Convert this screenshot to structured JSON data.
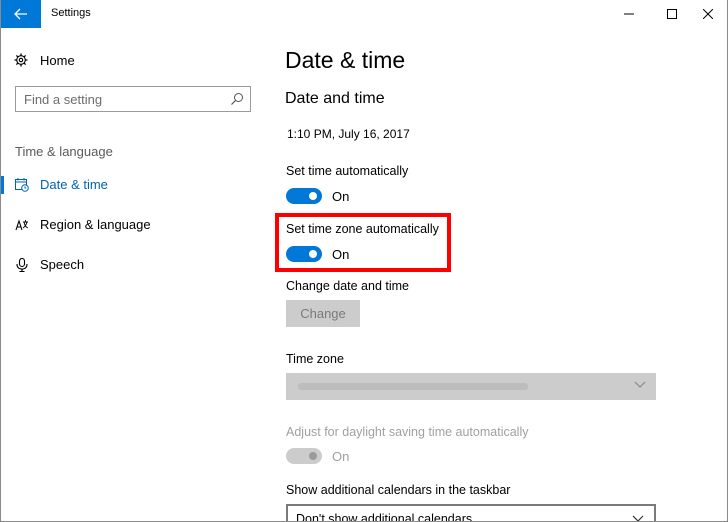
{
  "window": {
    "title": "Settings"
  },
  "sidebar": {
    "home_label": "Home",
    "search_placeholder": "Find a setting",
    "section_label": "Time & language",
    "items": [
      {
        "label": "Date & time",
        "icon": "calendar-clock-icon",
        "selected": true
      },
      {
        "label": "Region & language",
        "icon": "language-icon",
        "selected": false
      },
      {
        "label": "Speech",
        "icon": "microphone-icon",
        "selected": false
      }
    ]
  },
  "main": {
    "page_title": "Date & time",
    "section_title": "Date and time",
    "current_datetime": "1:10 PM, July 16, 2017",
    "set_time_auto": {
      "label": "Set time automatically",
      "state": "On"
    },
    "set_tz_auto": {
      "label": "Set time zone automatically",
      "state": "On"
    },
    "change_datetime": {
      "label": "Change date and time",
      "button": "Change"
    },
    "time_zone": {
      "label": "Time zone"
    },
    "daylight": {
      "label": "Adjust for daylight saving time automatically",
      "state": "On"
    },
    "calendars": {
      "label": "Show additional calendars in the taskbar",
      "value": "Don't show additional calendars"
    }
  },
  "colors": {
    "accent": "#0078d7",
    "highlight": "#ff0000",
    "disabled": "#cccccc"
  }
}
